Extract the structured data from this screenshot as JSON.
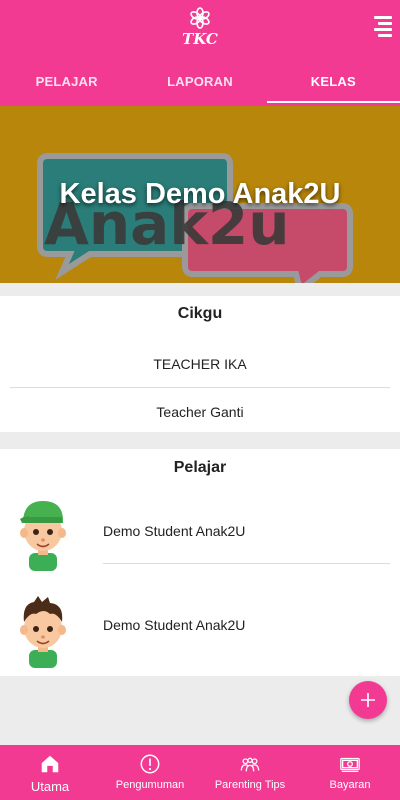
{
  "header": {
    "logo_text": "TKC",
    "menu_icon": "menu-icon",
    "tabs": [
      {
        "label": "PELAJAR",
        "active": false
      },
      {
        "label": "LAPORAN",
        "active": false
      },
      {
        "label": "KELAS",
        "active": true
      }
    ]
  },
  "banner": {
    "title": "Kelas Demo Anak2U",
    "art_text": "Anak2u"
  },
  "teachers": {
    "title": "Cikgu",
    "items": [
      "TEACHER IKA",
      "Teacher Ganti"
    ]
  },
  "students": {
    "title": "Pelajar",
    "items": [
      {
        "name": "Demo Student Anak2U",
        "avatar": "boy-green-cap-avatar"
      },
      {
        "name": "Demo Student Anak2U",
        "avatar": "boy-brown-hair-avatar"
      }
    ]
  },
  "fab": {
    "icon": "plus-icon"
  },
  "bottom_nav": [
    {
      "label": "Utama",
      "icon": "home-icon",
      "active": true
    },
    {
      "label": "Pengumuman",
      "icon": "alert-circle-icon",
      "active": false
    },
    {
      "label": "Parenting Tips",
      "icon": "people-icon",
      "active": false
    },
    {
      "label": "Bayaran",
      "icon": "money-icon",
      "active": false
    }
  ],
  "colors": {
    "primary": "#f23a93",
    "banner_bg": "#b8860b",
    "background": "#ececec"
  }
}
